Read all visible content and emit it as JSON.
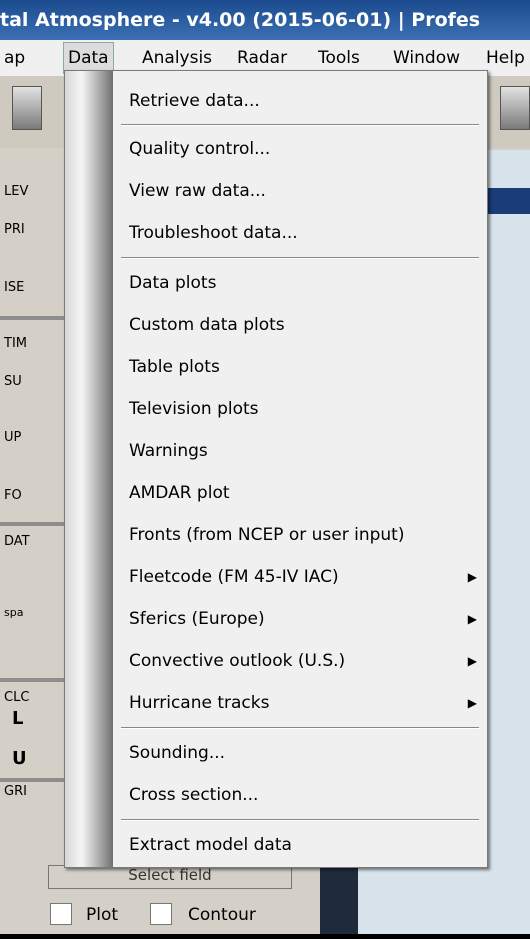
{
  "window": {
    "title": "tal Atmosphere - v4.00 (2015-06-01) | Profes"
  },
  "menubar": {
    "items": [
      {
        "label": "ap"
      },
      {
        "label": "Data"
      },
      {
        "label": "Analysis"
      },
      {
        "label": "Radar"
      },
      {
        "label": "Tools"
      },
      {
        "label": "Window"
      },
      {
        "label": "Help"
      }
    ]
  },
  "leftpanel": {
    "labels": [
      "LEV",
      "PRI",
      "ISE",
      "TIM",
      "SU",
      "UP",
      "FO",
      "DAT",
      "spa",
      "CLC",
      "L",
      "U",
      "GRI"
    ],
    "select_field": "Select field",
    "plot_label": "Plot",
    "contour_label": "Contour"
  },
  "menu": {
    "items": [
      {
        "label": "Retrieve data..."
      },
      {
        "label": "Quality control..."
      },
      {
        "label": "View raw data..."
      },
      {
        "label": "Troubleshoot data..."
      },
      {
        "label": "Data plots"
      },
      {
        "label": "Custom data plots"
      },
      {
        "label": "Table plots"
      },
      {
        "label": "Television plots"
      },
      {
        "label": "Warnings"
      },
      {
        "label": "AMDAR plot"
      },
      {
        "label": "Fronts (from NCEP or user input)"
      },
      {
        "label": "Fleetcode (FM 45-IV IAC)",
        "submenu": true
      },
      {
        "label": "Sferics (Europe)",
        "submenu": true
      },
      {
        "label": "Convective outlook (U.S.)",
        "submenu": true
      },
      {
        "label": "Hurricane tracks",
        "submenu": true
      },
      {
        "label": "Sounding..."
      },
      {
        "label": "Cross section..."
      },
      {
        "label": "Extract model data"
      }
    ],
    "submenu_arrow": "▶"
  }
}
